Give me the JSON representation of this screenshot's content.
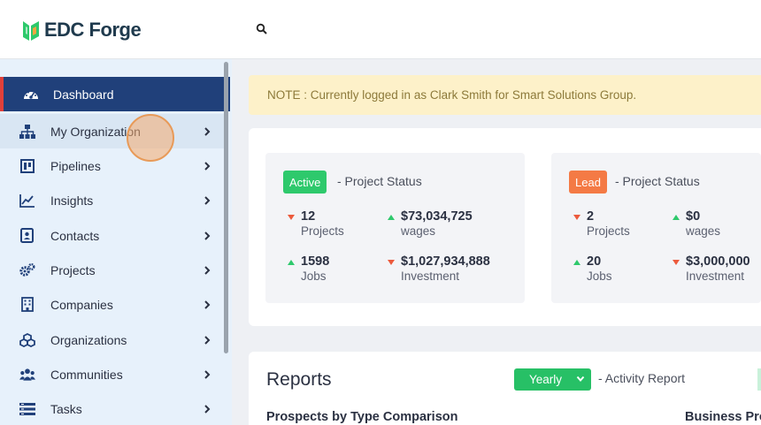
{
  "brand": {
    "name": "EDC Forge",
    "accent": "#2ec96c",
    "navy": "#20407a"
  },
  "header": {
    "search_icon": "search-icon"
  },
  "sidebar": {
    "items": [
      {
        "label": "Dashboard",
        "icon": "dashboard-gauge-icon",
        "active": true
      },
      {
        "label": "My Organization",
        "icon": "org-chart-icon"
      },
      {
        "label": "Pipelines",
        "icon": "pipeline-board-icon"
      },
      {
        "label": "Insights",
        "icon": "line-chart-icon"
      },
      {
        "label": "Contacts",
        "icon": "contact-card-icon"
      },
      {
        "label": "Projects",
        "icon": "gears-icon"
      },
      {
        "label": "Companies",
        "icon": "building-icon"
      },
      {
        "label": "Organizations",
        "icon": "cubes-icon"
      },
      {
        "label": "Communities",
        "icon": "users-icon"
      },
      {
        "label": "Tasks",
        "icon": "tasks-list-icon"
      }
    ]
  },
  "note": "NOTE : Currently logged in as Clark Smith for Smart Solutions Group.",
  "status_cards": [
    {
      "badge": "Active",
      "badge_color": "#2ec96c",
      "title": "- Project Status",
      "metrics": [
        {
          "value": "12",
          "label": "Projects",
          "trend": "down"
        },
        {
          "value": "$73,034,725",
          "label": "wages",
          "trend": "up"
        },
        {
          "value": "1598",
          "label": "Jobs",
          "trend": "up"
        },
        {
          "value": "$1,027,934,888",
          "label": "Investment",
          "trend": "down"
        }
      ]
    },
    {
      "badge": "Lead",
      "badge_color": "#f47a45",
      "title": "- Project Status",
      "metrics": [
        {
          "value": "2",
          "label": "Projects",
          "trend": "down"
        },
        {
          "value": "$0",
          "label": "wages",
          "trend": "up"
        },
        {
          "value": "20",
          "label": "Jobs",
          "trend": "up"
        },
        {
          "value": "$3,000,000",
          "label": "Investment",
          "trend": "down"
        }
      ]
    }
  ],
  "reports": {
    "title": "Reports",
    "period_select": "Yearly",
    "activity_label": "- Activity Report",
    "left_heading": "Prospects by Type Comparison",
    "right_heading": "Business Pro"
  }
}
